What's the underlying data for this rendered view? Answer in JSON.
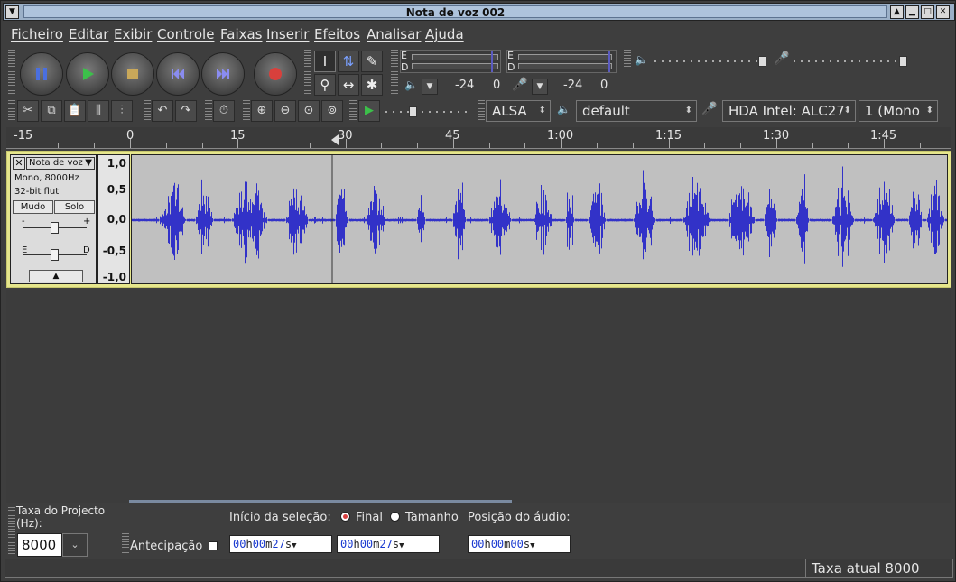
{
  "window": {
    "title": "Nota de voz 002"
  },
  "menu": [
    "Ficheiro",
    "Editar",
    "Exibir",
    "Controle",
    "Faixas",
    "Inserir",
    "Efeitos",
    "Analisar",
    "Ajuda"
  ],
  "meters": {
    "play": {
      "left_label": "E",
      "right_label": "D",
      "db_a": "-24",
      "db_b": "0"
    },
    "record": {
      "left_label": "E",
      "right_label": "D",
      "db_a": "-24",
      "db_b": "0"
    }
  },
  "device": {
    "host": "ALSA",
    "playback": "default",
    "recording": "HDA Intel: ALC27",
    "channels": "1 (Mono"
  },
  "ruler": [
    "-15",
    "0",
    "15",
    "30",
    "45",
    "1:00",
    "1:15",
    "1:30",
    "1:45"
  ],
  "track": {
    "name": "Nota de voz",
    "info1": "Mono, 8000Hz",
    "info2": "32-bit flut",
    "mute": "Mudo",
    "solo": "Solo",
    "gain_minus": "-",
    "gain_plus": "+",
    "pan_left": "E",
    "pan_right": "D",
    "scale": [
      "1,0",
      "0,5",
      "0,0",
      "-0,5",
      "-1,0"
    ],
    "wave_color": "#3232c8"
  },
  "selection": {
    "project_rate_label": "Taxa do Projecto (Hz):",
    "project_rate": "8000",
    "snap_label": "Antecipação",
    "start_label": "Início da seleção:",
    "end_option": "Final",
    "length_option": "Tamanho",
    "audio_pos_label": "Posição do áudio:",
    "start_time": [
      "00",
      "h",
      "00",
      "m",
      "27",
      "s"
    ],
    "end_time": [
      "00",
      "h",
      "00",
      "m",
      "27",
      "s"
    ],
    "audio_time": [
      "00",
      "h",
      "00",
      "m",
      "00",
      "s"
    ]
  },
  "status": {
    "right": "Taxa atual 8000"
  }
}
